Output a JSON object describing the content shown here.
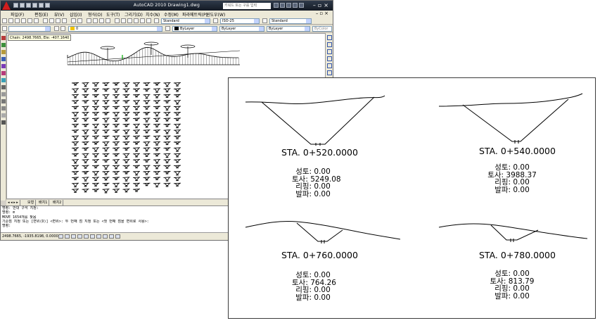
{
  "app": {
    "title": "AutoCAD 2010  Drawing1.dwg",
    "search_placeholder": "키워드 또는 구를 입력",
    "brand_color": "#d11d1d"
  },
  "menu": [
    "파일(F)",
    "편집(E)",
    "뷰(V)",
    "삽입(I)",
    "형식(O)",
    "도구(T)",
    "그리기(D)",
    "치수(N)",
    "수정(M)",
    "파라메트릭(P)",
    "윈도우(W)"
  ],
  "toolbar": {
    "text_style": "Standard",
    "dim_style": "ISO-25",
    "table_style": "Standard",
    "layer": "0",
    "color": "ByLayer",
    "linetype": "ByLayer",
    "lineweight": "ByLayer",
    "plot_style": "ByColor"
  },
  "viewport": {
    "coord_tooltip": "Chain: 2498.7665,  Ele: -407.1640"
  },
  "tabs": [
    "모형",
    "배치1",
    "배치2"
  ],
  "command_history": [
    "명령: 반대 구석 지정:",
    "명령: m",
    "MOVE 1654개를 찾음",
    "기준점 지정 또는 [변위(D)] <변위>: 두 번째 점 지정 또는 <첫 번째 점을 변위로 사용>:",
    "명령:"
  ],
  "status": {
    "coordinates": "2498.7665, -1935.8198, 0.0000",
    "model_label": "모형"
  },
  "sections": [
    {
      "station": "STA. 0+520.0000",
      "lines": [
        "성토: 0.00",
        "토사: 5249.08",
        "리핑: 0.00",
        "발파: 0.00"
      ]
    },
    {
      "station": "STA. 0+540.0000",
      "lines": [
        "성토: 0.00",
        "토사: 3988.37",
        "리핑: 0.00",
        "발파: 0.00"
      ]
    },
    {
      "station": "STA. 0+760.0000",
      "lines": [
        "성토: 0.00",
        "토사: 764.26",
        "리핑: 0.00",
        "발파: 0.00"
      ]
    },
    {
      "station": "STA. 0+780.0000",
      "lines": [
        "성토: 0.00",
        "토사: 813.79",
        "리핑: 0.00",
        "발파: 0.00"
      ]
    }
  ]
}
